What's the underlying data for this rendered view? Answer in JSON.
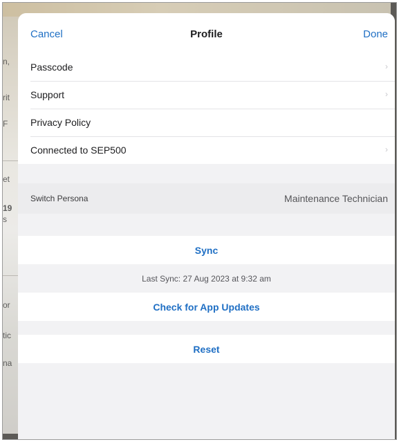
{
  "background_fragments": [
    "n,",
    "rit",
    "F",
    "et",
    "19",
    "s",
    "or",
    "tic",
    "na"
  ],
  "nav": {
    "cancel": "Cancel",
    "title": "Profile",
    "done": "Done"
  },
  "settings": {
    "items": [
      {
        "label": "Passcode",
        "chevron": true
      },
      {
        "label": "Support",
        "chevron": true
      },
      {
        "label": "Privacy Policy",
        "chevron": false
      },
      {
        "label": "Connected to SEP500",
        "chevron": true
      }
    ]
  },
  "persona": {
    "label": "Switch Persona",
    "value": "Maintenance Technician"
  },
  "sync": {
    "button": "Sync",
    "last_sync": "Last Sync: 27 Aug 2023 at 9:32 am"
  },
  "updates": {
    "button": "Check for App Updates"
  },
  "reset": {
    "button": "Reset"
  },
  "colors": {
    "accent": "#1f6fc4",
    "sheet_background": "#f2f2f4"
  }
}
